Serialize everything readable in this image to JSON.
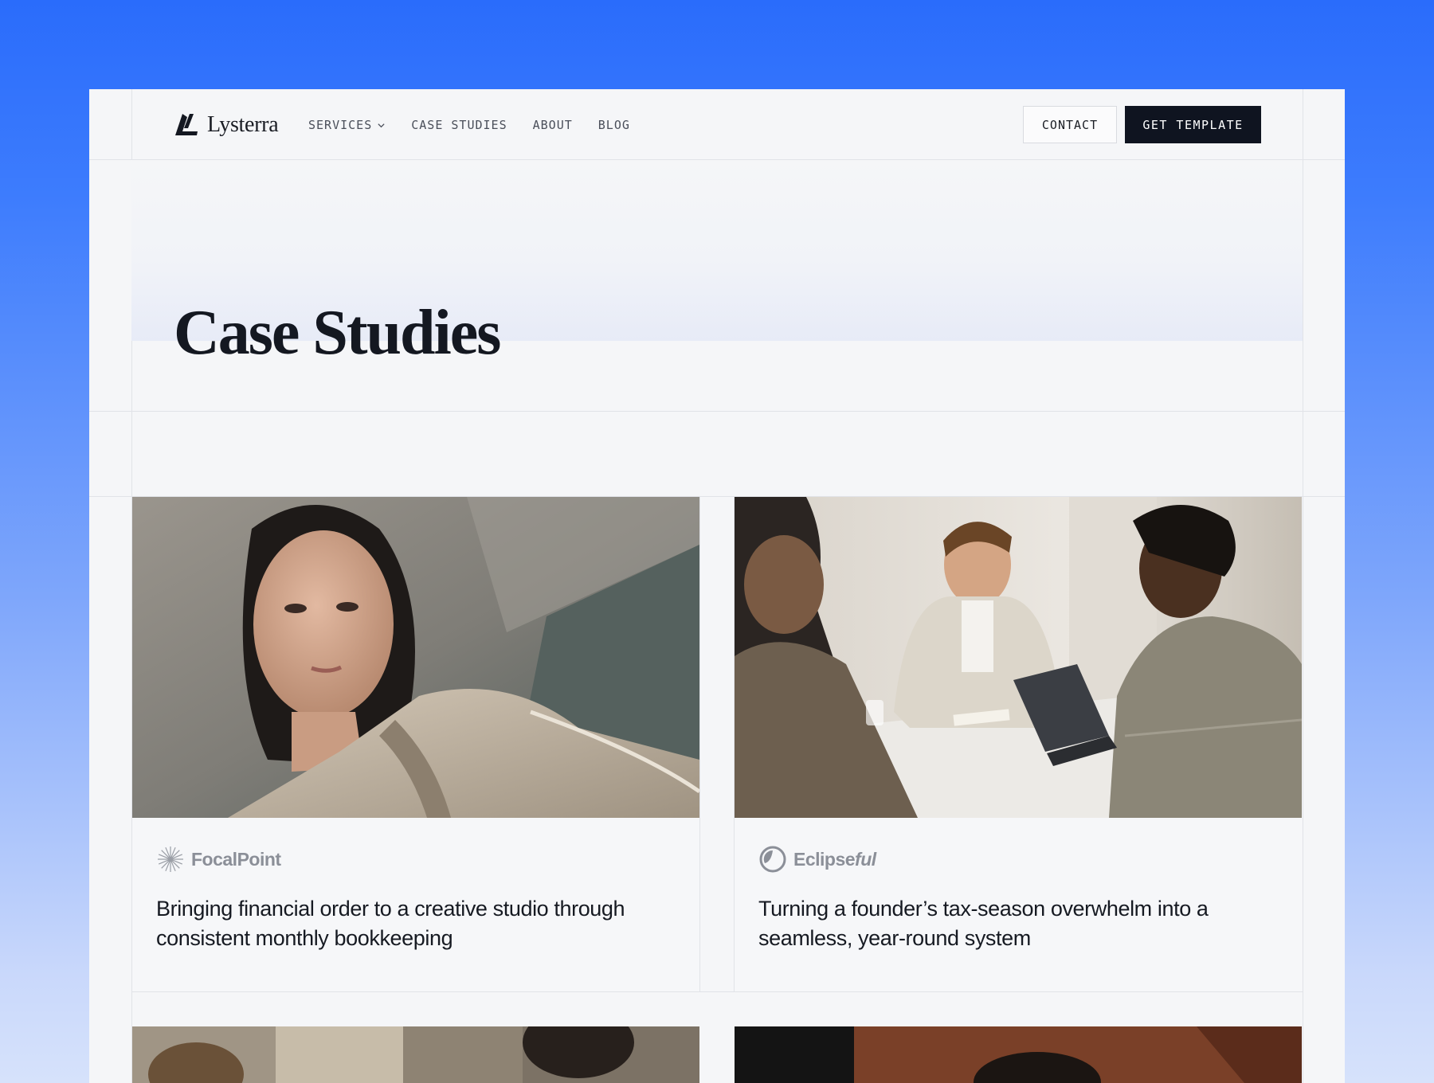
{
  "header": {
    "logo_text": "Lysterra",
    "nav": [
      {
        "label": "SERVICES",
        "has_dropdown": true
      },
      {
        "label": "CASE STUDIES"
      },
      {
        "label": "ABOUT"
      },
      {
        "label": "BLOG"
      }
    ],
    "contact_label": "CONTACT",
    "cta_label": "GET TEMPLATE"
  },
  "hero": {
    "title": "Case Studies"
  },
  "cases": [
    {
      "brand": "FocalPoint",
      "brand_icon": "sunburst-icon",
      "title": "Bringing financial order to a creative studio through consistent monthly bookkeeping"
    },
    {
      "brand": "Eclipse",
      "brand_suffix": "ful",
      "brand_icon": "eclipse-icon",
      "title": "Turning a founder’s tax-season overwhelm into a seamless, year-round system"
    }
  ],
  "colors": {
    "background_top": "#2a6cfb",
    "page": "#f5f6f8",
    "cta": "#0f1420",
    "text": "#141821",
    "brand_gray": "#8b8f98"
  }
}
